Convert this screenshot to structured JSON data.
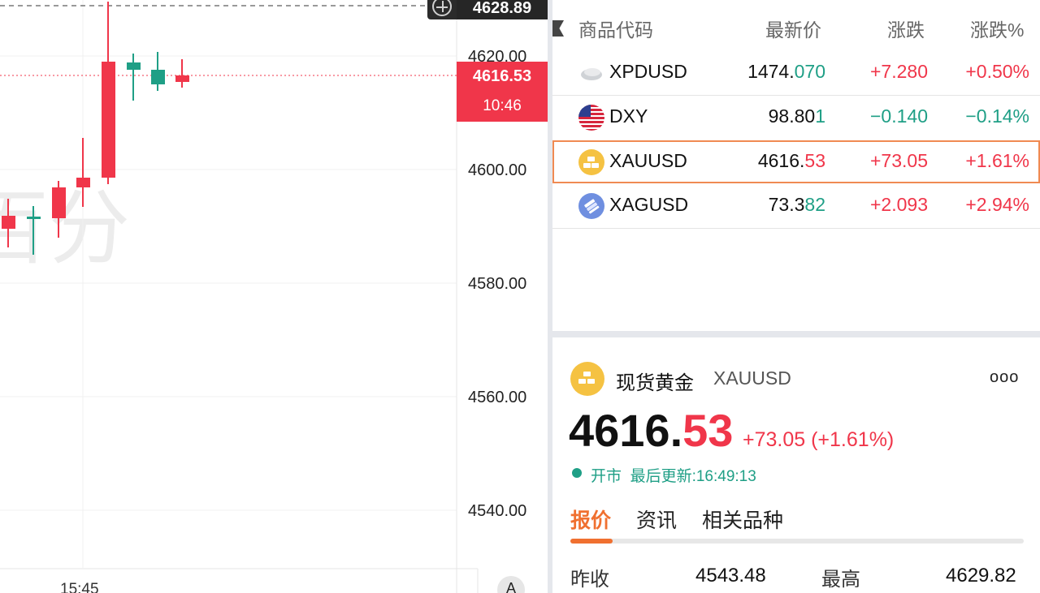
{
  "chart": {
    "price_axis": [
      "4620.00",
      "4600.00",
      "4580.00",
      "4560.00",
      "4540.00"
    ],
    "crosshair_price": "4628.89",
    "last_price": "4616.53",
    "countdown": "10:46",
    "time_label": "15:45",
    "auto_button": "A",
    "watermark": "百分",
    "colors": {
      "up": "#f0364a",
      "down": "#1f9f86"
    }
  },
  "watchlist": {
    "headers": {
      "code": "商品代码",
      "price": "最新价",
      "change": "涨跌",
      "percent": "涨跌%"
    },
    "rows": [
      {
        "icon": "palladium-icon",
        "code": "XPDUSD",
        "price_main": "1474.",
        "price_tail": "070",
        "tail_dir": "down",
        "change": "+7.280",
        "change_dir": "up",
        "percent": "+0.50%",
        "percent_dir": "up"
      },
      {
        "icon": "us-flag-icon",
        "code": "DXY",
        "price_main": "98.80",
        "price_tail": "1",
        "tail_dir": "down",
        "change": "−0.140",
        "change_dir": "down",
        "percent": "−0.14%",
        "percent_dir": "down"
      },
      {
        "icon": "gold-icon",
        "code": "XAUUSD",
        "price_main": "4616.",
        "price_tail": "53",
        "tail_dir": "up",
        "change": "+73.05",
        "change_dir": "up",
        "percent": "+1.61%",
        "percent_dir": "up"
      },
      {
        "icon": "silver-icon",
        "code": "XAGUSD",
        "price_main": "73.3",
        "price_tail": "82",
        "tail_dir": "down",
        "change": "+2.093",
        "change_dir": "up",
        "percent": "+2.94%",
        "percent_dir": "up"
      }
    ]
  },
  "detail": {
    "name_cn": "现货黄金",
    "code": "XAUUSD",
    "more": "ooo",
    "price_main": "4616.",
    "price_tail": "53",
    "change_text": "+73.05 (+1.61%)",
    "status": "开市",
    "updated": "最后更新:16:49:13",
    "tabs": [
      "报价",
      "资讯",
      "相关品种"
    ],
    "quote": {
      "prev_close_label": "昨收",
      "prev_close": "4543.48",
      "high_label": "最高",
      "high": "4629.82"
    }
  }
}
